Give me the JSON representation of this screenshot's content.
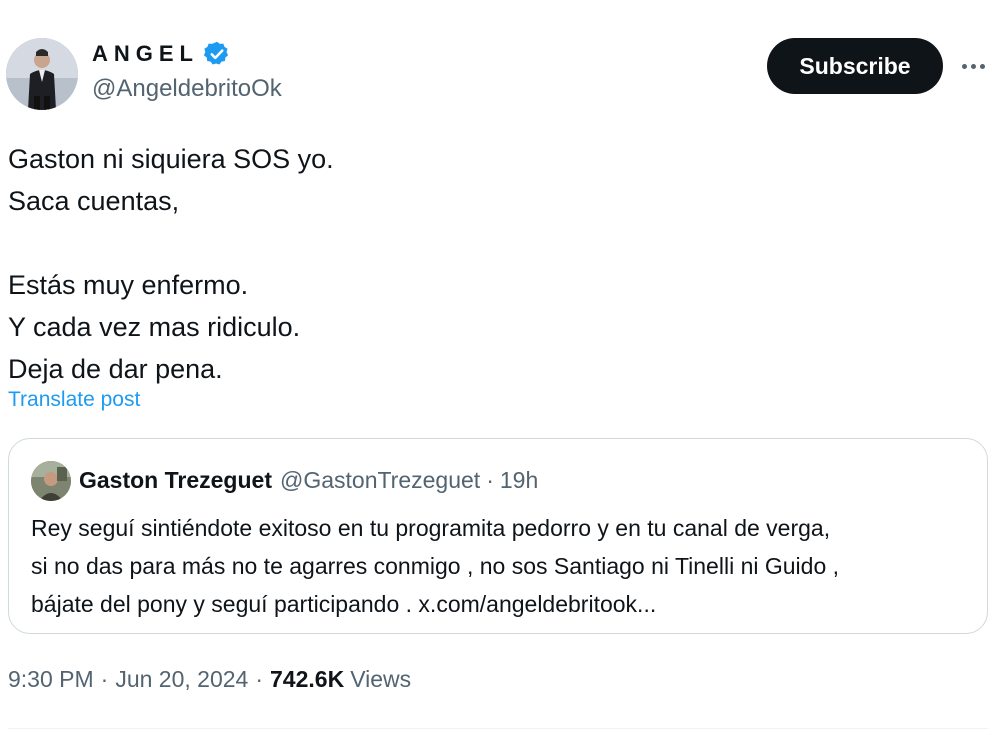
{
  "author": {
    "display_name": "ANGEL",
    "handle": "@AngeldebritoOk",
    "verified": true
  },
  "actions": {
    "subscribe_label": "Subscribe",
    "more_icon": "more-horizontal-icon"
  },
  "tweet": {
    "lines": [
      "Gaston ni siquiera SOS yo.",
      "Saca cuentas,",
      "",
      "Estás muy enfermo.",
      "Y cada vez mas ridiculo.",
      "Deja de dar pena."
    ],
    "translate_label": "Translate post"
  },
  "quote": {
    "display_name": "Gaston Trezeguet",
    "handle": "@GastonTrezeguet",
    "separator": "·",
    "time": "19h",
    "lines": [
      "Rey seguí sintiéndote exitoso en tu programita pedorro y en tu canal de verga,",
      "si no das para más no te agarres conmigo , no sos Santiago ni Tinelli ni Guido ,",
      "bájate del pony y seguí participando . x.com/angeldebritook..."
    ]
  },
  "meta": {
    "time": "9:30 PM",
    "separator": "·",
    "date": "Jun 20, 2024",
    "views_count": "742.6K",
    "views_label": "Views"
  },
  "colors": {
    "text_primary": "#0f1419",
    "text_secondary": "#536471",
    "link": "#1d9bf0",
    "verified_badge": "#1d9bf0",
    "border": "#cfd9de",
    "button_bg": "#0f1419"
  }
}
